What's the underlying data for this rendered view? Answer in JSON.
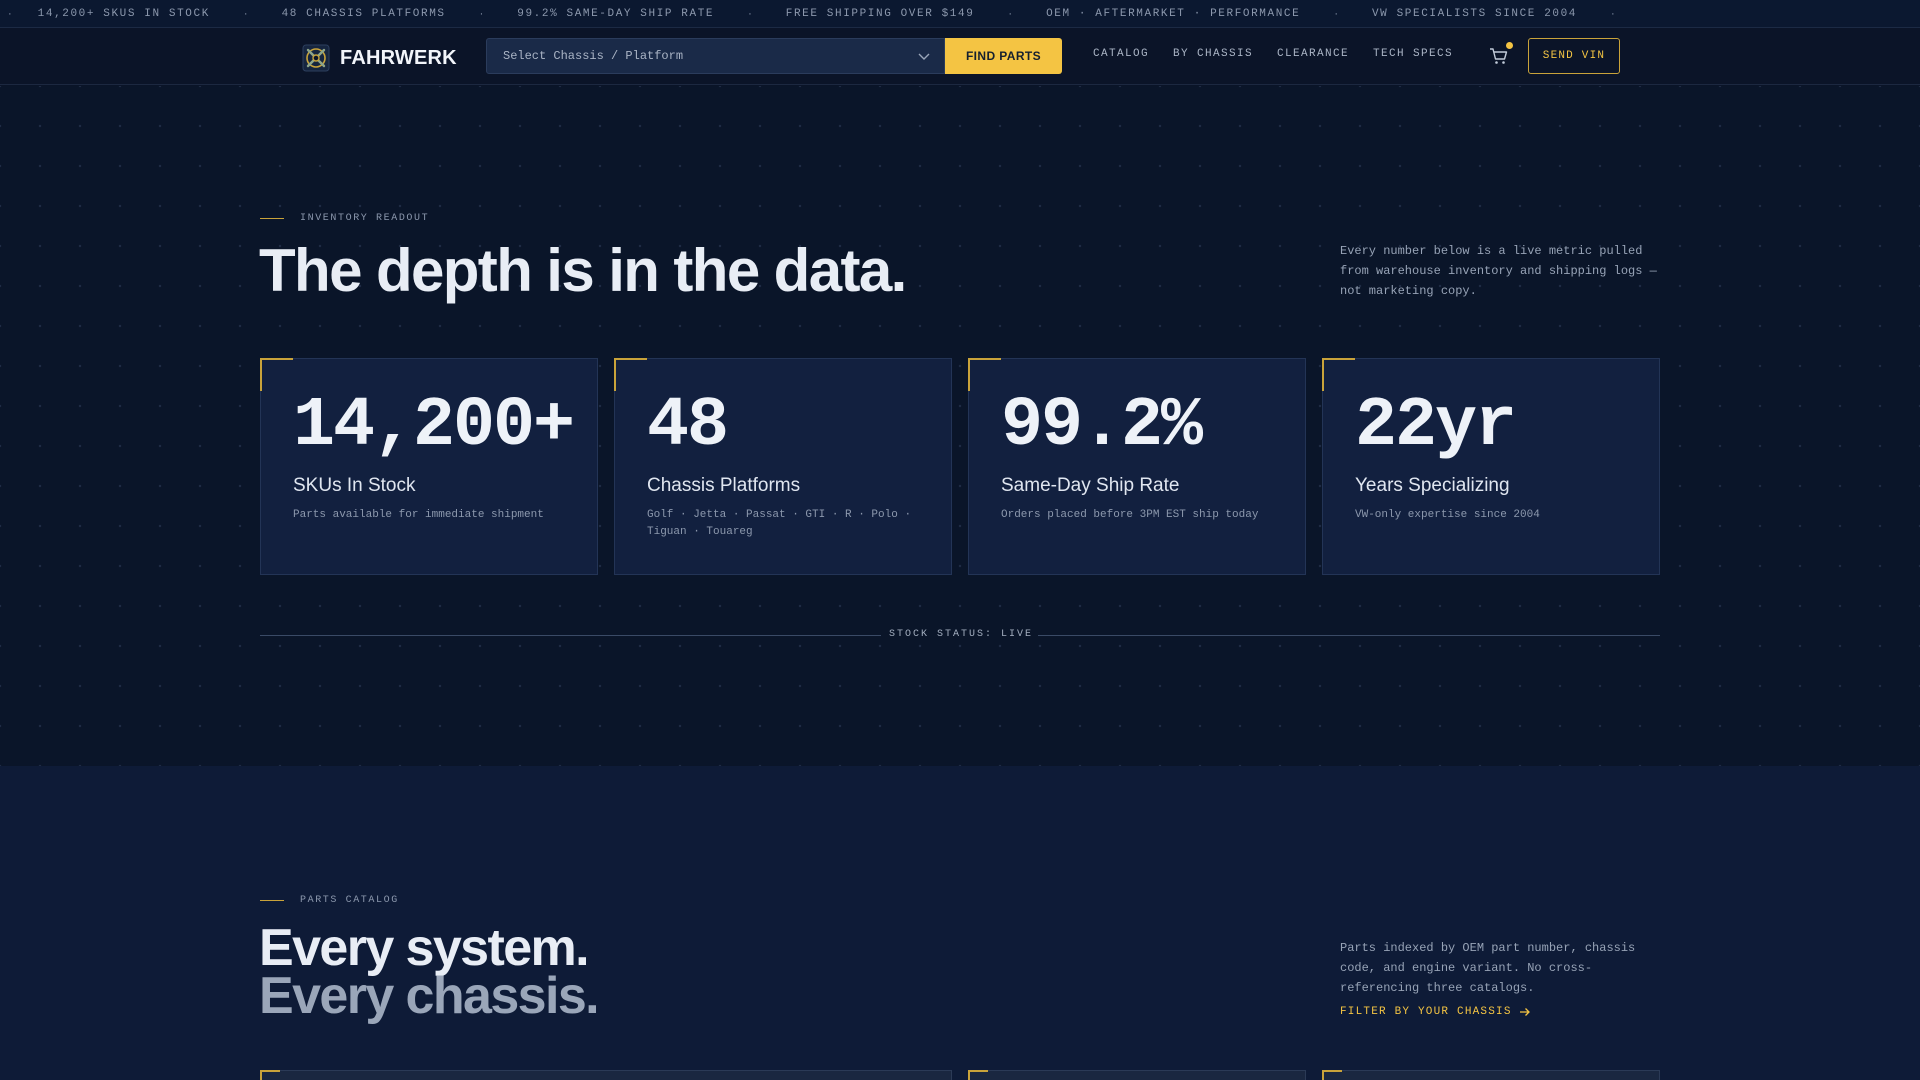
{
  "ticker": {
    "items": [
      "14,200+ SKUs IN STOCK",
      "48 CHASSIS PLATFORMS",
      "99.2% SAME-DAY SHIP RATE",
      "FREE SHIPPING OVER $149",
      "OEM · AFTERMARKET · PERFORMANCE",
      "VW SPECIALISTS SINCE 2004"
    ],
    "separator": "·"
  },
  "nav": {
    "brand": "FAHRWERK",
    "chassis_placeholder": "Select Chassis / Platform",
    "find_label": "FIND PARTS",
    "links": [
      "CATALOG",
      "BY CHASSIS",
      "CLEARANCE",
      "TECH SPECS"
    ],
    "vin_label": "SEND VIN",
    "accent": "#f4c443"
  },
  "inventory": {
    "eyebrow": "INVENTORY READOUT",
    "title": "The depth is in the data.",
    "side_copy": "Every number below is a live metric pulled from warehouse inventory and shipping logs — not marketing copy.",
    "cards": [
      {
        "value": "14,200+",
        "label": "SKUs In Stock",
        "sub": "Parts available for immediate shipment"
      },
      {
        "value": "48",
        "label": "Chassis Platforms",
        "sub": "Golf · Jetta · Passat · GTI · R · Polo · Tiguan · Touareg"
      },
      {
        "value": "99.2%",
        "label": "Same-Day Ship Rate",
        "sub": "Orders placed before 3PM EST ship today"
      },
      {
        "value": "22yr",
        "label": "Years Specializing",
        "sub": "VW-only expertise since 2004"
      }
    ],
    "status": "STOCK STATUS: LIVE"
  },
  "catalog": {
    "eyebrow": "PARTS CATALOG",
    "title_line1": "Every system.",
    "title_line2": "Every chassis.",
    "side_copy": "Parts indexed by OEM part number, chassis code, and engine variant. No cross-referencing three catalogs.",
    "filter_label": "FILTER BY YOUR CHASSIS"
  }
}
